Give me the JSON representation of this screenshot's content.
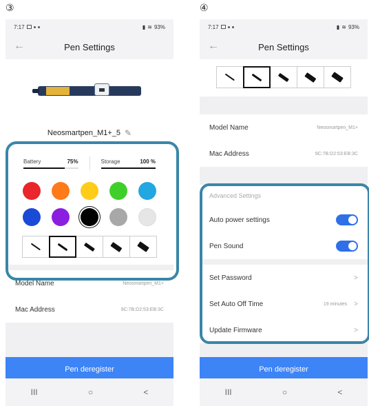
{
  "labels": {
    "step3": "③",
    "step4": "④"
  },
  "status_bar": {
    "time": "7:17",
    "battery_text": "93%"
  },
  "header": {
    "title": "Pen Settings"
  },
  "pen": {
    "name": "Neosmartpen_M1+_5"
  },
  "levels": {
    "battery_label": "Battery",
    "battery_value": "75%",
    "battery_fraction": 0.75,
    "storage_label": "Storage",
    "storage_value": "100 %",
    "storage_fraction": 1.0
  },
  "colors": [
    "#e8262b",
    "#ff7a18",
    "#ffcc1a",
    "#3fcf2a",
    "#22a7e0",
    "#1a4bd6",
    "#8a1fe0",
    "#000000",
    "#a8a8a8",
    "#e6e6e6"
  ],
  "selected_color_index": 7,
  "thickness": {
    "count": 5,
    "selected_index": 1
  },
  "info": {
    "model_label": "Model Name",
    "model_value": "Neosmartpen_M1+",
    "mac_label": "Mac Address",
    "mac_value": "9C:7B:D2:53:EB:3C"
  },
  "advanced": {
    "header": "Advanced Settings",
    "auto_power_label": "Auto power settings",
    "auto_power_on": true,
    "pen_sound_label": "Pen Sound",
    "pen_sound_on": true,
    "set_password_label": "Set Password",
    "auto_off_label": "Set Auto Off Time",
    "auto_off_value": "19 minutes",
    "firmware_label": "Update Firmware"
  },
  "deregister_label": "Pen deregister",
  "nav": {
    "recent": "III",
    "home": "○",
    "back": "<"
  },
  "accent_color": "#3d84f7",
  "highlight_color": "#3a86a8"
}
